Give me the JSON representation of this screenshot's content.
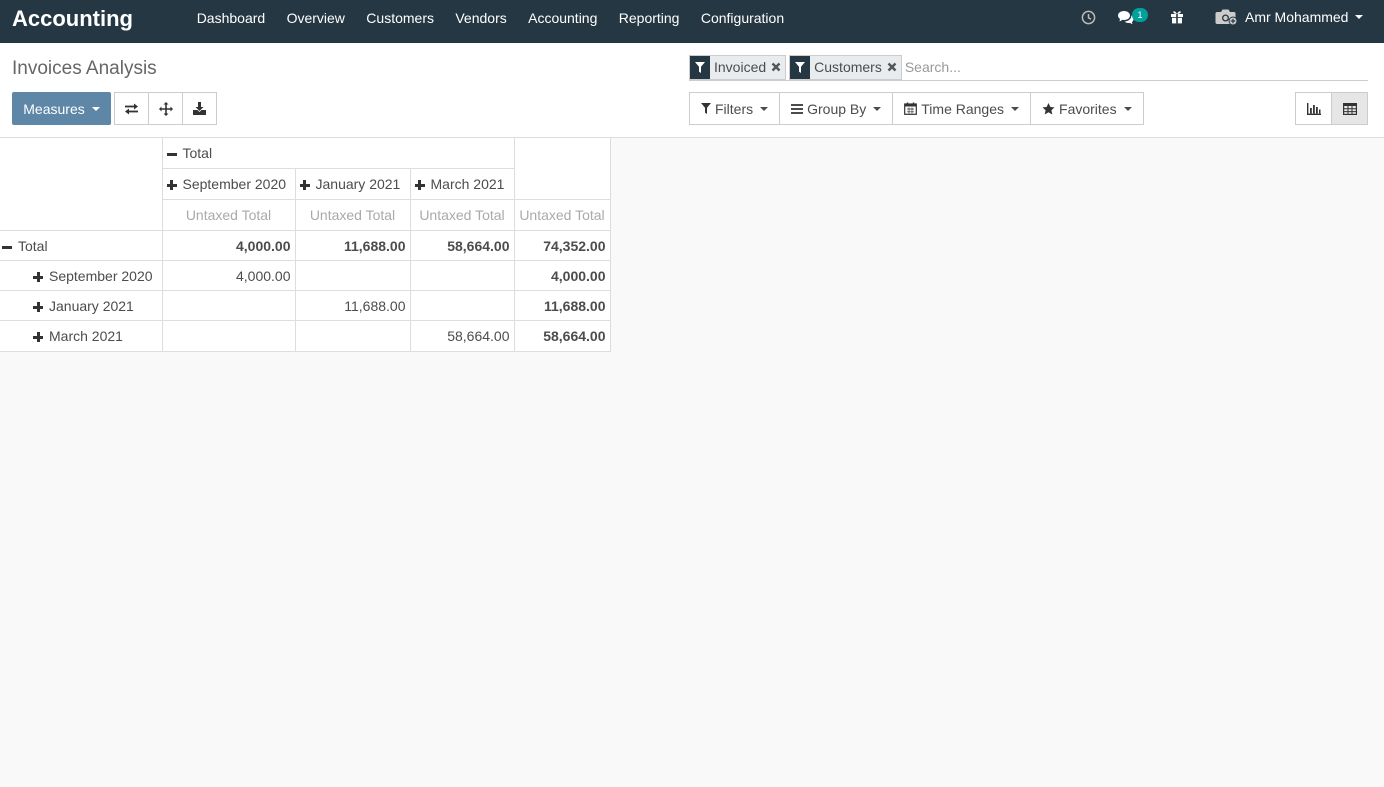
{
  "navbar": {
    "brand": "Accounting",
    "menu": [
      "Dashboard",
      "Overview",
      "Customers",
      "Vendors",
      "Accounting",
      "Reporting",
      "Configuration"
    ],
    "messages_count": "1",
    "user_name": "Amr Mohammed"
  },
  "control_panel": {
    "title": "Invoices Analysis",
    "facets": [
      "Invoiced",
      "Customers"
    ],
    "search_placeholder": "Search...",
    "measures_label": "Measures",
    "search_options": {
      "filters": "Filters",
      "group_by": "Group By",
      "time_ranges": "Time Ranges",
      "favorites": "Favorites"
    },
    "active_view": "pivot"
  },
  "pivot": {
    "column_header_total": "Total",
    "column_groups": [
      "September 2020",
      "January 2021",
      "March 2021"
    ],
    "measure": "Untaxed Total",
    "rows": {
      "total": {
        "label": "Total",
        "values": [
          "4,000.00",
          "11,688.00",
          "58,664.00",
          "74,352.00"
        ]
      },
      "sep2020": {
        "label": "September 2020",
        "values": [
          "4,000.00",
          "",
          "",
          "4,000.00"
        ]
      },
      "jan2021": {
        "label": "January 2021",
        "values": [
          "",
          "11,688.00",
          "",
          "11,688.00"
        ]
      },
      "mar2021": {
        "label": "March 2021",
        "values": [
          "",
          "",
          "58,664.00",
          "58,664.00"
        ]
      }
    }
  }
}
